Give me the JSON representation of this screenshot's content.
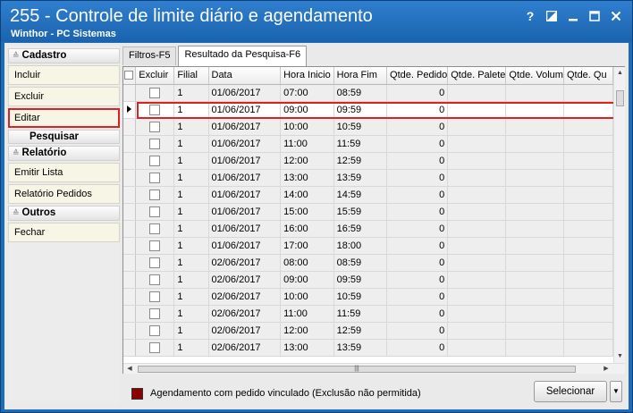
{
  "window": {
    "title": "255 - Controle de limite diário e agendamento",
    "subtitle": "Winthor - PC Sistemas",
    "help_glyph": "?"
  },
  "sidebar": {
    "cadastro": {
      "label": "Cadastro",
      "items": [
        "Incluir",
        "Excluir",
        "Editar"
      ],
      "selected": "Editar"
    },
    "pesquisar": {
      "label": "Pesquisar"
    },
    "relatorio": {
      "label": "Relatório",
      "items": [
        "Emitir Lista",
        "Relatório Pedidos"
      ]
    },
    "outros": {
      "label": "Outros",
      "items": [
        "Fechar"
      ]
    }
  },
  "tabs": [
    {
      "label": "Filtros-F5",
      "active": false
    },
    {
      "label": "Resultado da Pesquisa-F6",
      "active": true
    }
  ],
  "grid": {
    "columns": [
      "Excluir",
      "Filial",
      "Data",
      "Hora Inicio",
      "Hora Fim",
      "Qtde. Pedido",
      "Qtde. Palete",
      "Qtde. Volum",
      "Qtde. Qu"
    ],
    "current_row_index": 1,
    "rows": [
      [
        "1",
        "01/06/2017",
        "07:00",
        "08:59",
        "0"
      ],
      [
        "1",
        "01/06/2017",
        "09:00",
        "09:59",
        "0"
      ],
      [
        "1",
        "01/06/2017",
        "10:00",
        "10:59",
        "0"
      ],
      [
        "1",
        "01/06/2017",
        "11:00",
        "11:59",
        "0"
      ],
      [
        "1",
        "01/06/2017",
        "12:00",
        "12:59",
        "0"
      ],
      [
        "1",
        "01/06/2017",
        "13:00",
        "13:59",
        "0"
      ],
      [
        "1",
        "01/06/2017",
        "14:00",
        "14:59",
        "0"
      ],
      [
        "1",
        "01/06/2017",
        "15:00",
        "15:59",
        "0"
      ],
      [
        "1",
        "01/06/2017",
        "16:00",
        "16:59",
        "0"
      ],
      [
        "1",
        "01/06/2017",
        "17:00",
        "18:00",
        "0"
      ],
      [
        "1",
        "02/06/2017",
        "08:00",
        "08:59",
        "0"
      ],
      [
        "1",
        "02/06/2017",
        "09:00",
        "09:59",
        "0"
      ],
      [
        "1",
        "02/06/2017",
        "10:00",
        "10:59",
        "0"
      ],
      [
        "1",
        "02/06/2017",
        "11:00",
        "11:59",
        "0"
      ],
      [
        "1",
        "02/06/2017",
        "12:00",
        "12:59",
        "0"
      ],
      [
        "1",
        "02/06/2017",
        "13:00",
        "13:59",
        "0"
      ]
    ]
  },
  "legend": {
    "text": "Agendamento com pedido vinculado (Exclusão não permitida)",
    "color": "#8b0000"
  },
  "footer": {
    "select_button": "Selecionar"
  },
  "colors": {
    "titlebar": "#1e6bb8",
    "highlight": "#e02020"
  }
}
